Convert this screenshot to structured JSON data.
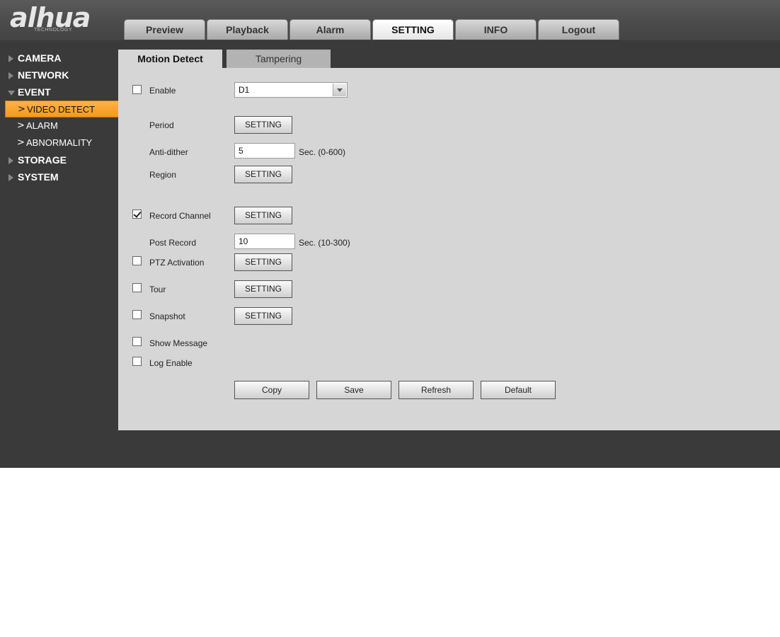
{
  "brand": {
    "logo_text": "alhua",
    "logo_sub": "TECHNOLOGY"
  },
  "nav": {
    "tabs": [
      {
        "label": "Preview"
      },
      {
        "label": "Playback"
      },
      {
        "label": "Alarm"
      },
      {
        "label": "SETTING",
        "active": true
      },
      {
        "label": "INFO"
      },
      {
        "label": "Logout"
      }
    ]
  },
  "sidebar": {
    "camera": "CAMERA",
    "network": "NETWORK",
    "event": "EVENT",
    "event_items": [
      "VIDEO DETECT",
      "ALARM",
      "ABNORMALITY"
    ],
    "storage": "STORAGE",
    "system": "SYSTEM"
  },
  "subtabs": {
    "motion": "Motion Detect",
    "tampering": "Tampering"
  },
  "form": {
    "enable": {
      "label": "Enable",
      "checked": false,
      "channel": "D1"
    },
    "period": {
      "label": "Period",
      "button": "SETTING"
    },
    "anti_dither": {
      "label": "Anti-dither",
      "value": "5",
      "unit": "Sec. (0-600)"
    },
    "region": {
      "label": "Region",
      "button": "SETTING"
    },
    "record_channel": {
      "label": "Record Channel",
      "checked": true,
      "button": "SETTING"
    },
    "post_record": {
      "label": "Post Record",
      "value": "10",
      "unit": "Sec. (10-300)"
    },
    "ptz_activation": {
      "label": "PTZ Activation",
      "checked": false,
      "button": "SETTING"
    },
    "tour": {
      "label": "Tour",
      "checked": false,
      "button": "SETTING"
    },
    "snapshot": {
      "label": "Snapshot",
      "checked": false,
      "button": "SETTING"
    },
    "show_message": {
      "label": "Show Message",
      "checked": false
    },
    "log_enable": {
      "label": "Log Enable",
      "checked": false
    }
  },
  "actions": {
    "copy": "Copy",
    "save": "Save",
    "refresh": "Refresh",
    "default": "Default"
  },
  "colors": {
    "accent": "#f39a1a",
    "panel": "#d6d6d6",
    "chrome": "#3a3a3a"
  }
}
